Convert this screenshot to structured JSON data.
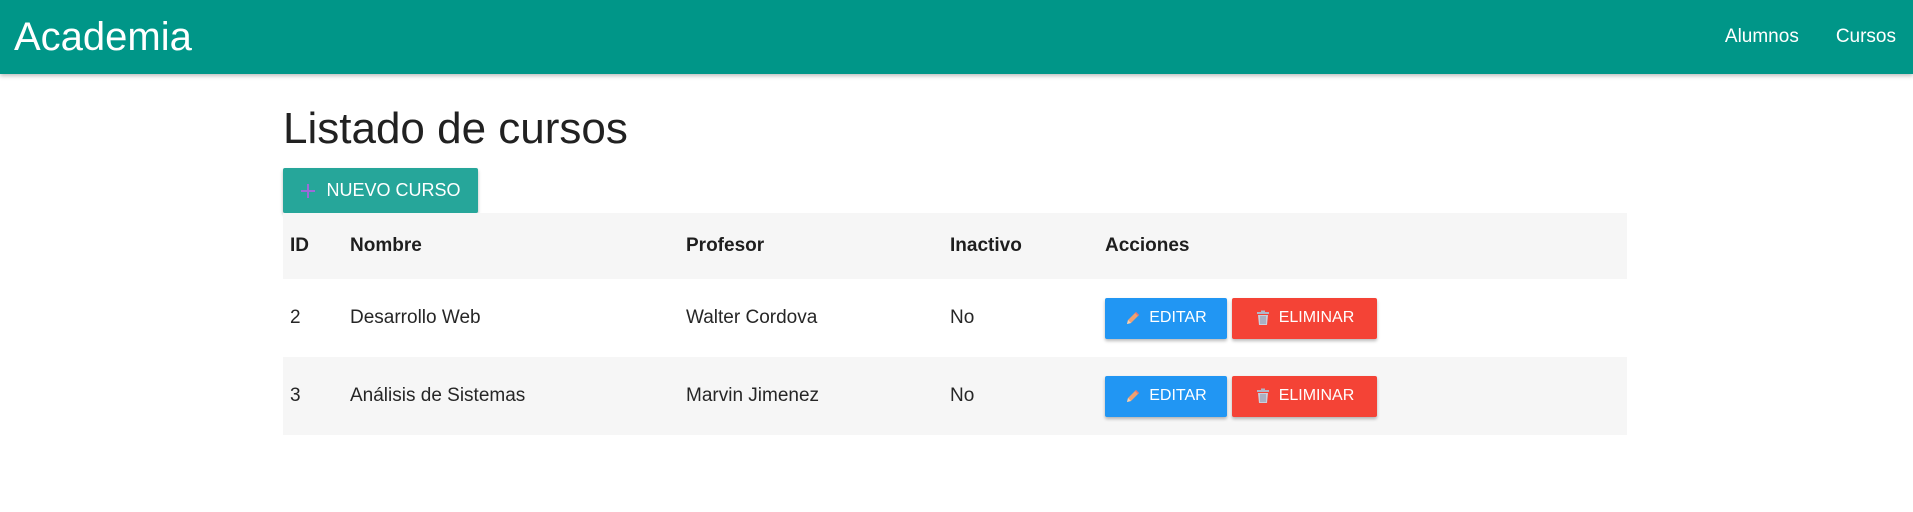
{
  "navbar": {
    "brand": "Academia",
    "links": [
      "Alumnos",
      "Cursos"
    ]
  },
  "page": {
    "title": "Listado de cursos",
    "new_button_label": "NUEVO CURSO"
  },
  "table": {
    "headers": [
      "ID",
      "Nombre",
      "Profesor",
      "Inactivo",
      "Acciones"
    ],
    "rows": [
      {
        "id": "2",
        "nombre": "Desarrollo Web",
        "profesor": "Walter Cordova",
        "inactivo": "No"
      },
      {
        "id": "3",
        "nombre": "Análisis de Sistemas",
        "profesor": "Marvin Jimenez",
        "inactivo": "No"
      }
    ],
    "edit_label": "EDITAR",
    "delete_label": "ELIMINAR"
  },
  "colors": {
    "navbar": "#009688",
    "new_button": "#26a69a",
    "edit_button": "#2196f3",
    "delete_button": "#f44336"
  },
  "icons": {
    "new": "plus-icon",
    "edit": "pencil-icon",
    "delete": "trash-icon"
  }
}
